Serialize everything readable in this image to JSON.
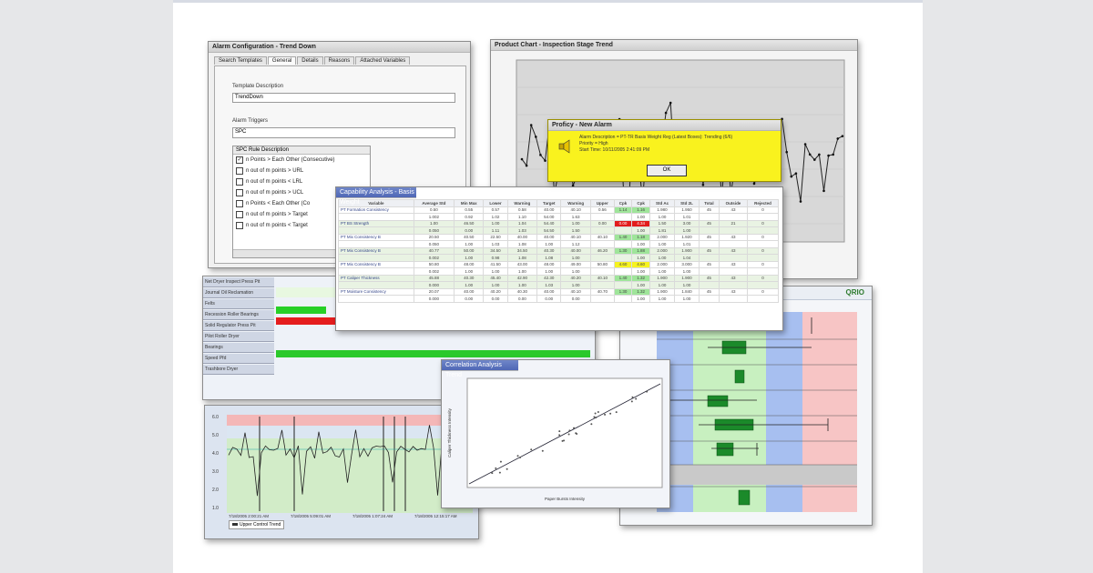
{
  "alarm_config": {
    "title": "Alarm Configuration - Trend Down",
    "tabs": [
      "Search Templates",
      "General",
      "Details",
      "Reasons",
      "Attached Variables"
    ],
    "active_tab": "General",
    "template_label": "Template Description",
    "template_value": "TrendDown",
    "triggers_label": "Alarm Triggers",
    "triggers_value": "SPC",
    "rules_header": "SPC Rule Description",
    "rules": [
      {
        "label": "n Points > Each Other (Consecutive)",
        "checked": true
      },
      {
        "label": "n out of m points > URL",
        "checked": false
      },
      {
        "label": "n out of m points < LRL",
        "checked": false
      },
      {
        "label": "n out of m points > UCL",
        "checked": false
      },
      {
        "label": "n Points < Each Other (Co",
        "checked": false
      },
      {
        "label": "n out of m points > Target",
        "checked": false
      },
      {
        "label": "n out of m points < Target",
        "checked": false
      }
    ]
  },
  "trend_window": {
    "title": "Product Chart - Inspection Stage Trend"
  },
  "alert": {
    "title": "Proficy - New Alarm",
    "line1": "Alarm Description = PT-TR Basis Weight Reg (Latest Boxes): Trending (6/6)",
    "line2": "Priority = High",
    "line3": "Start Time: 10/11/2005 2:41:09 PM",
    "ok_label": "OK"
  },
  "capability": {
    "title": "Capability Analysis - Basis Weight",
    "headers": [
      "Variable",
      "Average Std",
      "Min Max",
      "Lower",
      "Warning",
      "Target",
      "Warning",
      "Upper",
      "Cpk",
      "Cpk",
      "Std Ac",
      "Std 2L",
      "Total",
      "Outside",
      "Rejected"
    ],
    "rows": [
      {
        "name": "PT Formation Consistency",
        "a": [
          "0.50",
          "0.55",
          "0.57",
          "0.58",
          "40.00",
          "40.10",
          "0.56",
          "1.14",
          "1.16",
          "1.980",
          "1.950",
          "45",
          "43",
          "0"
        ],
        "b": [
          "1.002",
          "0.92",
          "1.02",
          "1.10",
          "54.00",
          "1.63",
          "",
          "",
          "1.00",
          "1.00",
          "1.01",
          "",
          "",
          ""
        ],
        "hl": "g"
      },
      {
        "name": "PT BS Strength",
        "a": [
          "1.00",
          "46.50",
          "1.00",
          "1.04",
          "54.40",
          "1.00",
          "0.00",
          "0.00",
          "4.34",
          "1.50",
          "3.00",
          "45",
          "21",
          "0"
        ],
        "b": [
          "0.050",
          "0.00",
          "1.11",
          "1.03",
          "54.50",
          "1.50",
          "",
          "",
          "1.00",
          "1.81",
          "1.00",
          "",
          "",
          ""
        ],
        "hl": "r"
      },
      {
        "name": "PT Mix Consistency B",
        "a": [
          "20.50",
          "40.50",
          "22.50",
          "40.00",
          "40.00",
          "40.10",
          "40.10",
          "1.40",
          "1.18",
          "2.000",
          "1.920",
          "45",
          "43",
          "0"
        ],
        "b": [
          "0.050",
          "1.00",
          "1.03",
          "1.08",
          "1.00",
          "1.12",
          "",
          "",
          "1.00",
          "1.00",
          "1.01",
          "",
          "",
          ""
        ],
        "hl": "g"
      },
      {
        "name": "PT Mix Consistency B",
        "a": [
          "40.77",
          "50.00",
          "34.50",
          "34.50",
          "40.30",
          "40.00",
          "46.20",
          "1.30",
          "1.88",
          "2.000",
          "1.900",
          "45",
          "43",
          "0"
        ],
        "b": [
          "0.002",
          "1.00",
          "0.98",
          "1.08",
          "1.08",
          "1.00",
          "",
          "",
          "1.00",
          "1.00",
          "1.04",
          "",
          "",
          ""
        ],
        "hl": "g"
      },
      {
        "name": "PT Mix Consistency B",
        "a": [
          "50.80",
          "48.00",
          "41.50",
          "43.00",
          "48.00",
          "49.00",
          "50.80",
          "4.60",
          "4.60",
          "2.000",
          "3.000",
          "45",
          "43",
          "0"
        ],
        "b": [
          "0.002",
          "1.00",
          "1.00",
          "1.00",
          "1.00",
          "1.00",
          "",
          "",
          "1.00",
          "1.00",
          "1.00",
          "",
          "",
          ""
        ],
        "hl": "y"
      },
      {
        "name": "PT Caliper Thickness",
        "a": [
          "45.88",
          "40.30",
          "45.40",
          "42.90",
          "42.30",
          "40.20",
          "40.10",
          "1.40",
          "1.32",
          "1.900",
          "1.900",
          "45",
          "43",
          "0"
        ],
        "b": [
          "0.000",
          "1.00",
          "1.00",
          "1.00",
          "1.03",
          "1.00",
          "",
          "",
          "1.00",
          "1.00",
          "1.00",
          "",
          "",
          ""
        ],
        "hl": "g"
      },
      {
        "name": "PT Moisture Consistency",
        "a": [
          "20.07",
          "40.00",
          "40.20",
          "40.30",
          "40.00",
          "40.10",
          "40.70",
          "1.30",
          "1.32",
          "1.900",
          "1.840",
          "45",
          "43",
          "0"
        ],
        "b": [
          "0.000",
          "0.00",
          "0.00",
          "0.00",
          "0.00",
          "0.00",
          "",
          "",
          "1.00",
          "1.00",
          "1.00",
          "",
          "",
          ""
        ],
        "hl": "g"
      }
    ]
  },
  "equipment": {
    "rows": [
      "Net Dryer Inspect Press Pit",
      "Journal Oil Reclamation",
      "Felts",
      "Recession Roller Bearings",
      "Solid Regulator Press Pit",
      "Pilot Roller Dryer",
      "Bearings",
      "Speed Pfd",
      "Trashbore Dryer"
    ]
  },
  "spc_chart": {
    "legend_label": "Upper Control Trend",
    "x_labels": [
      "7/18/2005 2:00:21 AM",
      "7/18/2005 5:09:01 AM",
      "7/18/2005 1:07:24 AM",
      "7/18/2005 12:15:17 AM"
    ],
    "y_labels": [
      "6.0",
      "5.0",
      "4.0",
      "3.0",
      "2.0",
      "1.0"
    ]
  },
  "scatter_window": {
    "title": "Correlation Analysis Trend",
    "xlabel": "Paper Bursts Intensity",
    "ylabel": "Caliper Thickness Intensity"
  },
  "boxplot_window": {
    "toolbar_label": "QRIO"
  },
  "colors": {
    "green_zone": "#c8f0c0",
    "red_zone": "#f8c8c8",
    "blue_zone": "#a8c0f0",
    "alert_yellow": "#f9f21e"
  }
}
